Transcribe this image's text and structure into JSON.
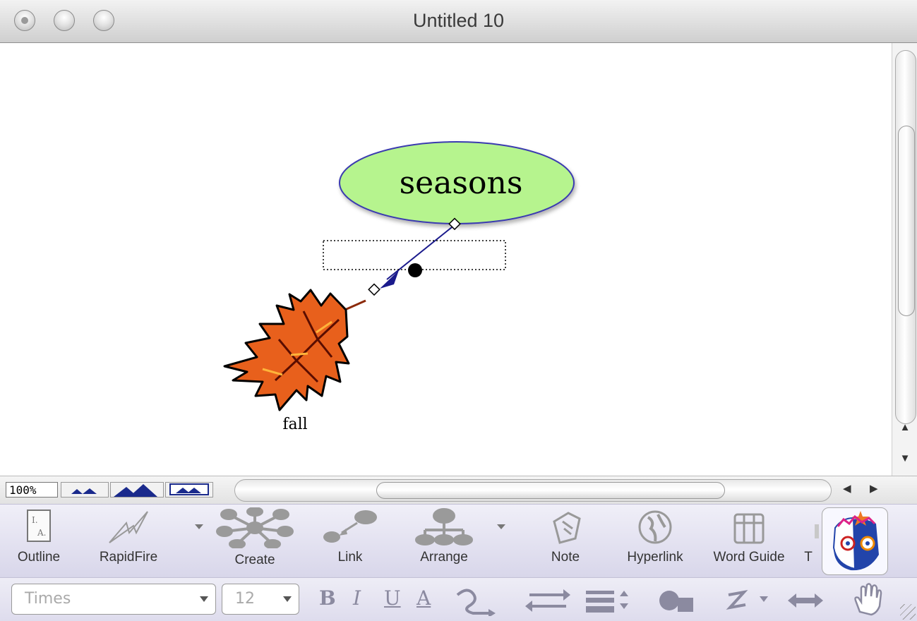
{
  "window": {
    "title": "Untitled 10"
  },
  "diagram": {
    "main_node": {
      "label": "seasons",
      "fill": "#b6f48e",
      "stroke": "#3b3bb0"
    },
    "child_node": {
      "label": "fall",
      "icon": "oak-leaf"
    },
    "link": {
      "color": "#1a1a8c"
    }
  },
  "view": {
    "zoom": "100%"
  },
  "toolbar": {
    "items": [
      {
        "label": "Outline",
        "icon": "outline-icon"
      },
      {
        "label": "RapidFire",
        "icon": "rapidfire-icon"
      },
      {
        "label": "Create",
        "icon": "create-icon"
      },
      {
        "label": "Link",
        "icon": "link-icon"
      },
      {
        "label": "Arrange",
        "icon": "arrange-icon"
      },
      {
        "label": "Note",
        "icon": "note-icon"
      },
      {
        "label": "Hyperlink",
        "icon": "hyperlink-icon"
      },
      {
        "label": "Word Guide",
        "icon": "word-guide-icon"
      },
      {
        "label": "T",
        "icon": "truncated-tool-icon"
      }
    ]
  },
  "format": {
    "font": "Times",
    "size": "12",
    "bold": "B",
    "italic": "I",
    "underline": "U",
    "color": "A"
  }
}
